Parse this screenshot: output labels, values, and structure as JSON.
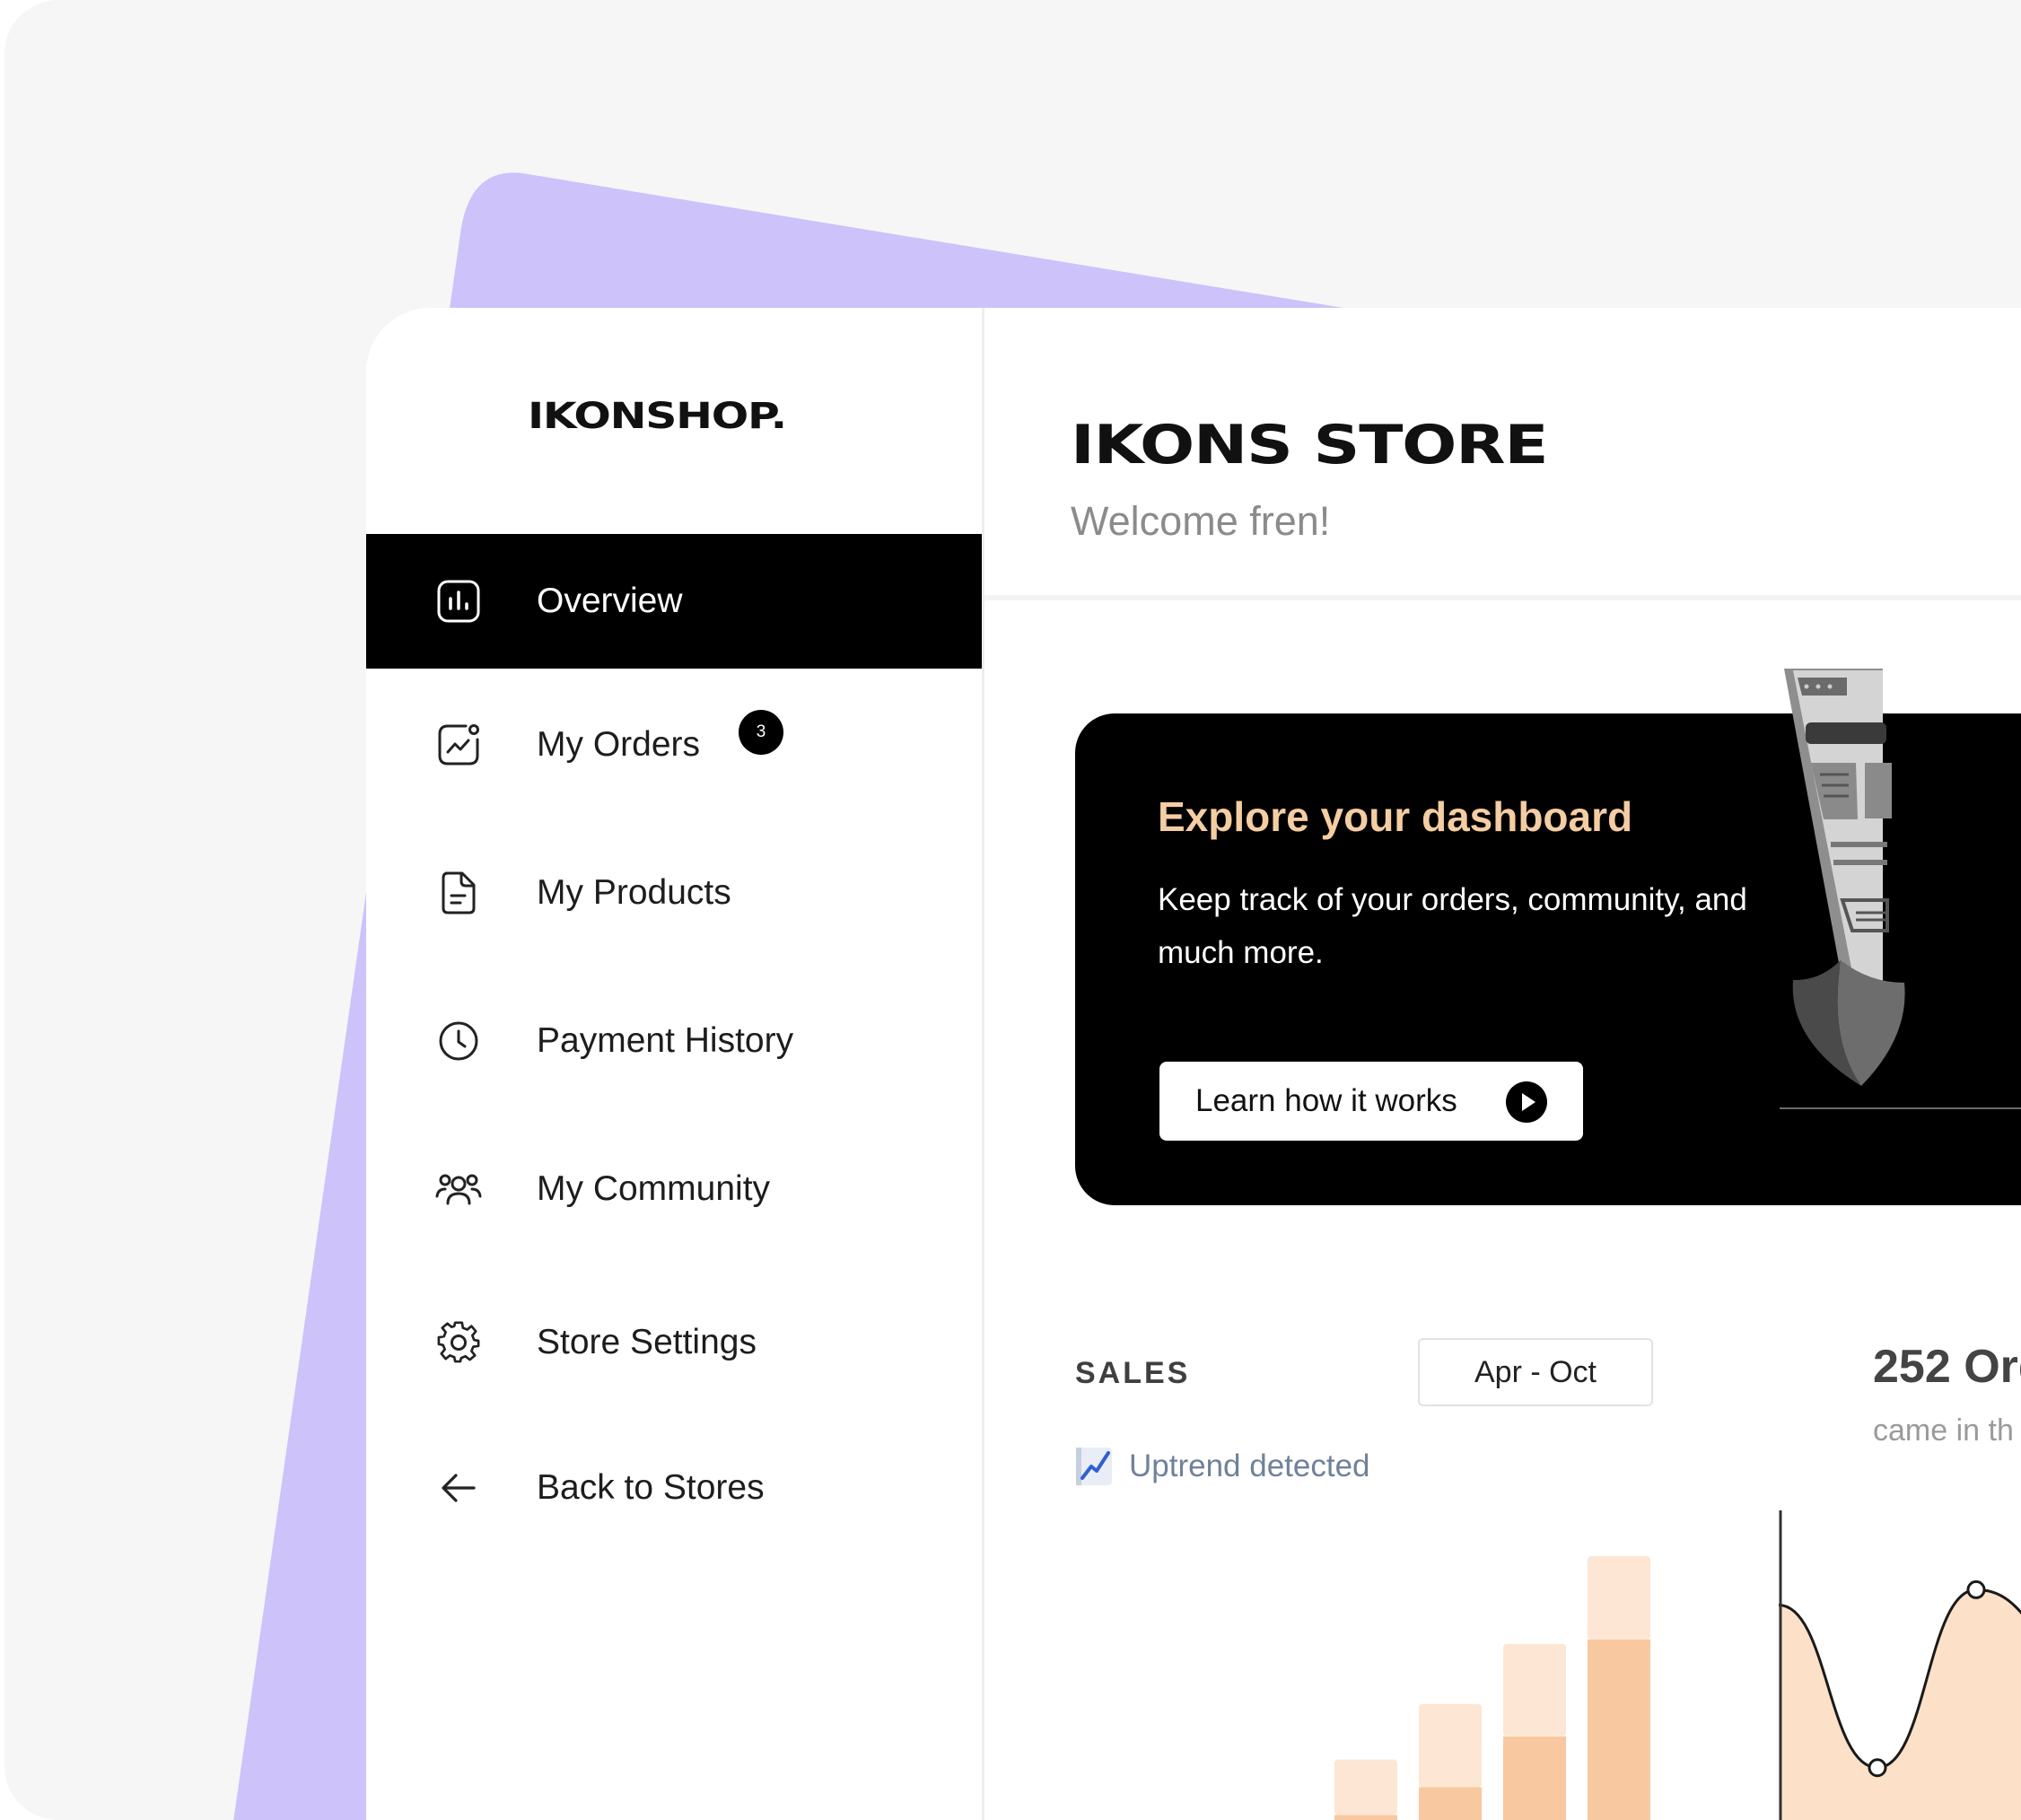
{
  "sidebar": {
    "logo": "IKONSHOP.",
    "items": [
      {
        "label": "Overview",
        "icon": "bar-chart-icon",
        "active": true
      },
      {
        "label": "My Orders",
        "icon": "trend-chart-icon",
        "badge": "3"
      },
      {
        "label": "My Products",
        "icon": "document-icon"
      },
      {
        "label": "Payment History",
        "icon": "clock-icon"
      },
      {
        "label": "My Community",
        "icon": "users-icon"
      },
      {
        "label": "Store Settings",
        "icon": "gear-icon"
      },
      {
        "label": "Back to Stores",
        "icon": "arrow-left-icon"
      }
    ]
  },
  "header": {
    "title": "IKONS STORE",
    "subtitle": "Welcome fren!"
  },
  "banner": {
    "title": "Explore your dashboard",
    "text": "Keep track of your orders, community, and much more.",
    "button_label": "Learn how it works",
    "button_icon": "play-circle-icon"
  },
  "sales": {
    "label": "SALES",
    "date_range": "Apr - Oct",
    "trend_label": "Uptrend detected",
    "trend_icon": "chart-emoji-icon"
  },
  "orders": {
    "count_text": "252 Ord",
    "sub_text": "came in th"
  },
  "colors": {
    "accent": "#f5cda3",
    "bar_light": "#fde6d3",
    "bar_dark": "#f8c9a0",
    "purple": "#cdc2fa"
  },
  "chart_data": [
    {
      "type": "bar",
      "stacked": true,
      "series": [
        {
          "values": [
            20,
            50,
            105,
            210
          ]
        },
        {
          "values": [
            60,
            90,
            100,
            90
          ]
        }
      ]
    },
    {
      "type": "area",
      "series": [
        {
          "values": [
            75,
            22,
            80,
            62
          ]
        }
      ]
    }
  ]
}
